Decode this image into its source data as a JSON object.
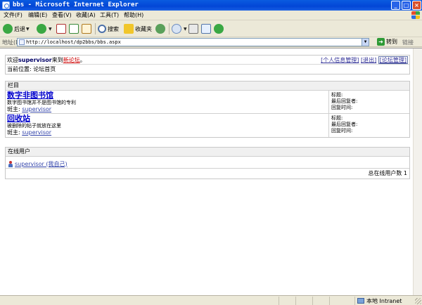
{
  "window": {
    "title": "bbs - Microsoft Internet Explorer",
    "btn_min": "_",
    "btn_max": "□",
    "btn_close": "×"
  },
  "menu": [
    "文件(F)",
    "编辑(E)",
    "查看(V)",
    "收藏(A)",
    "工具(T)",
    "帮助(H)"
  ],
  "toolbar": {
    "back": "后退",
    "search": "搜索",
    "favorites": "收藏夹"
  },
  "address": {
    "label": "地址(D)",
    "url": "http://localhost/dp2bbs/bbs.aspx",
    "go": "转到",
    "links": "链接"
  },
  "welcome": {
    "prefix": "欢迎",
    "user": "supervisor",
    "middle": "来到",
    "forum": "新论坛",
    "suffix": "。",
    "links": [
      "[个人信息管理]",
      "[退出]",
      "[论坛管理]"
    ]
  },
  "location": "当前位置: 论坛首页",
  "sections": {
    "header": "栏目",
    "items": [
      {
        "title": "数字非图书馆",
        "desc": "数字图书馆并不是图书馆的专利",
        "moderator_label": "斑主:",
        "moderator": "supervisor",
        "last_title": "标题:",
        "last_replier": "最后回复者:",
        "last_time": "回复时间:"
      },
      {
        "title": "回收站",
        "desc": "被删除的帖子就放在这里",
        "moderator_label": "斑主:",
        "moderator": "supervisor",
        "last_title": "标题:",
        "last_replier": "最后回复者:",
        "last_time": "回复时间:"
      }
    ]
  },
  "online": {
    "header": "在线用户",
    "user": "supervisor (我自己)",
    "count_text": "总在线用户数 1"
  },
  "status": {
    "zone": "本地 Intranet"
  },
  "colors": {
    "titlebar": "#0346d6",
    "forum_title": "#0000cc",
    "forum_link": "#cc0000"
  }
}
